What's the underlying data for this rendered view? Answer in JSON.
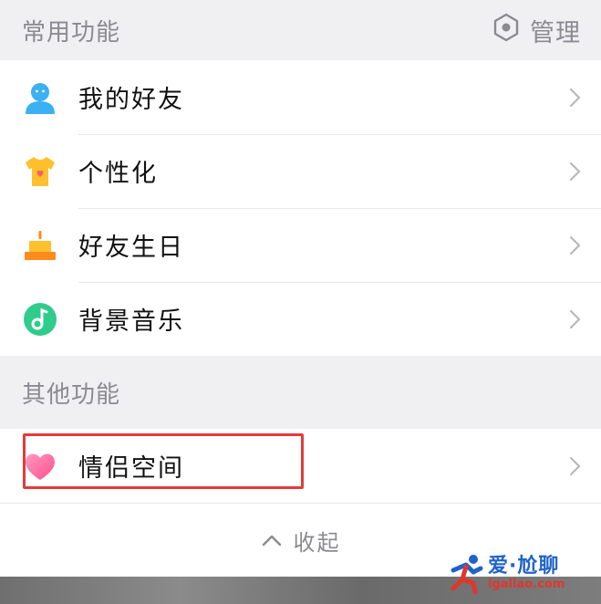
{
  "common_section": {
    "title": "常用功能",
    "manage_label": "管理",
    "items": [
      {
        "label": "我的好友",
        "icon": "friend-icon"
      },
      {
        "label": "个性化",
        "icon": "tshirt-icon"
      },
      {
        "label": "好友生日",
        "icon": "birthday-cake-icon"
      },
      {
        "label": "背景音乐",
        "icon": "music-icon"
      }
    ]
  },
  "other_section": {
    "title": "其他功能",
    "items": [
      {
        "label": "情侣空间",
        "icon": "heart-icon"
      }
    ]
  },
  "collapse_label": "收起",
  "watermark": {
    "title": "爱·尬聊",
    "url": "igaliao.com"
  },
  "colors": {
    "highlight_border": "#e23b3b",
    "section_text": "#8a8a90"
  }
}
